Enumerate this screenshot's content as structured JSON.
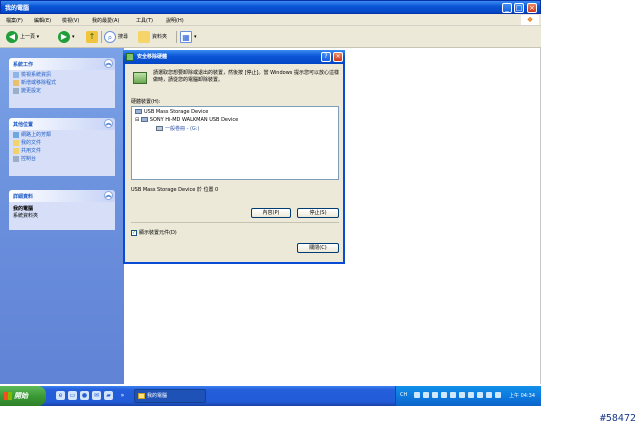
{
  "window": {
    "title": "我的電腦"
  },
  "menubar": {
    "items": [
      "檔案(F)",
      "編輯(E)",
      "檢視(V)",
      "我的最愛(A)",
      "工具(T)",
      "說明(H)"
    ]
  },
  "toolbar": {
    "back": "上一頁",
    "search": "搜尋",
    "folders": "資料夾"
  },
  "left_panel": {
    "system_tasks": {
      "title": "系統工作",
      "items": [
        "檢視系統資訊",
        "新增或移除程式",
        "變更設定"
      ]
    },
    "other_places": {
      "title": "其他位置",
      "items": [
        "網路上的芳鄰",
        "我的文件",
        "共用文件",
        "控制台"
      ]
    },
    "details": {
      "title": "詳細資料",
      "name": "我的電腦",
      "subtitle": "系統資料夾"
    }
  },
  "dialog": {
    "title": "安全移除硬體",
    "message": "請選取您想要卸除或退出的裝置，然後按 [停止]。當 Windows 提示您可以放心這樣做時，請從您的電腦卸除裝置。",
    "devices_label": "硬體裝置(H):",
    "tree": [
      "USB Mass Storage Device",
      "SONY Hi-MD WALKMAN USB Device",
      "一般卷冊 - (G:)"
    ],
    "status": "USB Mass Storage Device 於 位置 0",
    "properties_button": "內容(P)",
    "stop_button": "停止(S)",
    "checkbox_label": "顯示裝置元件(D)",
    "checkbox_checked": true,
    "close_button": "關閉(C)"
  },
  "taskbar": {
    "start_label": "開始",
    "task_button": "我的電腦",
    "tray_lang": "CH",
    "clock": "上午 04:34"
  },
  "image_tag": "#58472"
}
